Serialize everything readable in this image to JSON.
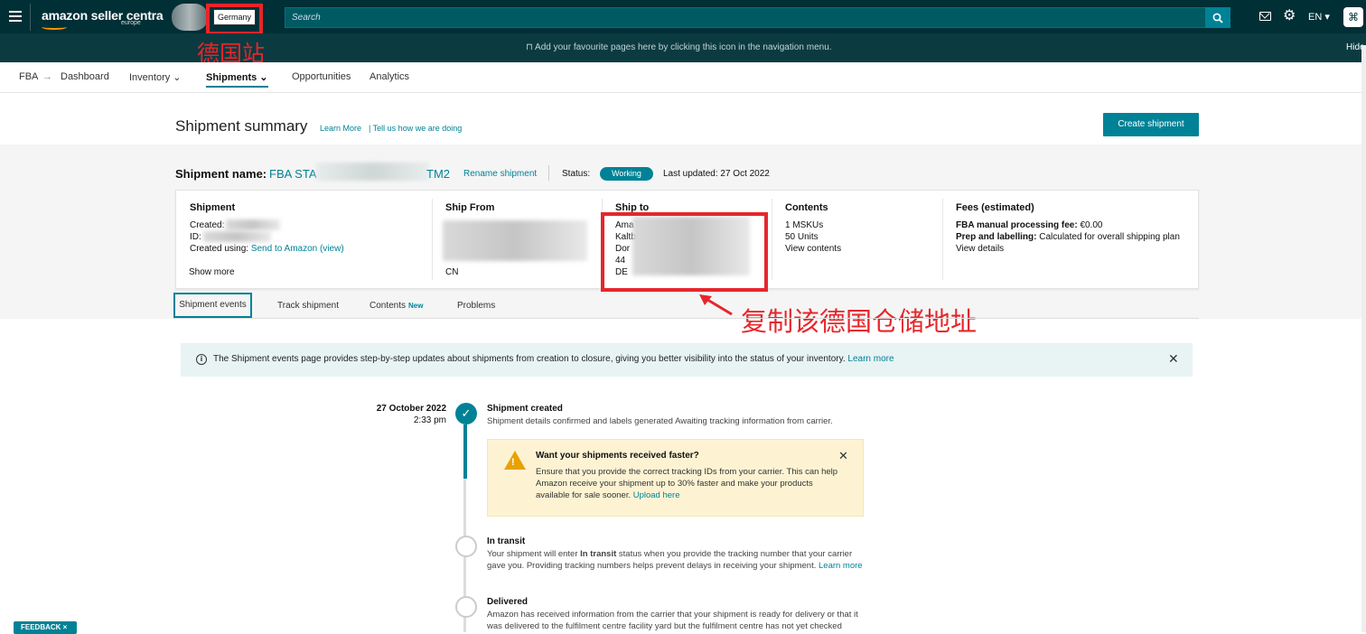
{
  "header": {
    "logo_text": "amazon seller centra",
    "logo_sub": "europe",
    "store_select": "Germany",
    "search_placeholder": "Search",
    "lang": "EN ▾",
    "icons": [
      "menu-icon",
      "search-icon",
      "mail-icon",
      "gear-icon",
      "profile-icon"
    ]
  },
  "annotations": {
    "store_note": "德国站",
    "copy_note": "复制该德国仓储地址"
  },
  "favbar": {
    "text": "Add your favourite pages here by clicking this icon in the navigation menu.",
    "hide": "Hide"
  },
  "nav": {
    "fba": "FBA",
    "arrow": "→",
    "dashboard": "Dashboard",
    "inventory": "Inventory ⌄",
    "shipments": "Shipments ⌄",
    "opportunities": "Opportunities",
    "analytics": "Analytics"
  },
  "summary": {
    "title": "Shipment summary",
    "learn_more": "Learn More",
    "tell_us": "|  Tell us how we are doing",
    "create_button": "Create shipment",
    "name_label": "Shipment name:",
    "name_prefix": "FBA STA",
    "name_suffix": "TM2",
    "rename": "Rename shipment",
    "status_label": "Status:",
    "status": "Working",
    "last_updated": "Last updated: 27 Oct 2022"
  },
  "card": {
    "shipment": {
      "head": "Shipment",
      "created": "Created:",
      "id": "ID:",
      "created_using_label": "Created using:",
      "created_using": "Send to Amazon (view)",
      "show_more": "Show more"
    },
    "ship_from": {
      "head": "Ship From",
      "country": "CN"
    },
    "ship_to": {
      "head": "Ship to",
      "l1": "Ama",
      "l2": "Kaltba",
      "l3": "Dor",
      "l4": "44",
      "l5": "DE"
    },
    "contents": {
      "head": "Contents",
      "mskus": "1 MSKUs",
      "units": "50 Units",
      "view": "View contents"
    },
    "fees": {
      "head": "Fees (estimated)",
      "manual_label": "FBA manual processing fee:",
      "manual_val": "€0.00",
      "prep_label": "Prep and labelling:",
      "prep_val": "Calculated for overall shipping plan",
      "view": "View details"
    }
  },
  "tabs": {
    "events": "Shipment events",
    "track": "Track shipment",
    "contents": "Contents",
    "contents_badge": "New",
    "problems": "Problems"
  },
  "banner": {
    "text": "The Shipment events page provides step-by-step updates about shipments from creation to closure, giving you better visibility into the status of your inventory.",
    "link": "Learn more"
  },
  "timeline": {
    "date": "27 October 2022",
    "time": "2:33 pm",
    "created_title": "Shipment created",
    "created_desc": "Shipment details confirmed and labels generated Awaiting tracking information from carrier.",
    "warn_title": "Want your shipments received faster?",
    "warn_body": "Ensure that you provide the correct tracking IDs from your carrier. This can help Amazon receive your shipment up to 30% faster and make your products available for sale sooner.",
    "warn_link": "Upload here",
    "transit_title": "In transit",
    "transit_desc_a": "Your shipment will enter",
    "transit_desc_b": "In transit",
    "transit_desc_c": "status when you provide the tracking number that your carrier gave you. Providing tracking numbers helps prevent delays in receiving your shipment.",
    "transit_link": "Learn more",
    "delivered_title": "Delivered",
    "delivered_desc": "Amazon has received information from the carrier that your shipment is ready for delivery or that it was delivered to the fulfilment centre facility yard but the fulfilment centre has not yet checked"
  },
  "feedback": "FEEDBACK ×"
}
